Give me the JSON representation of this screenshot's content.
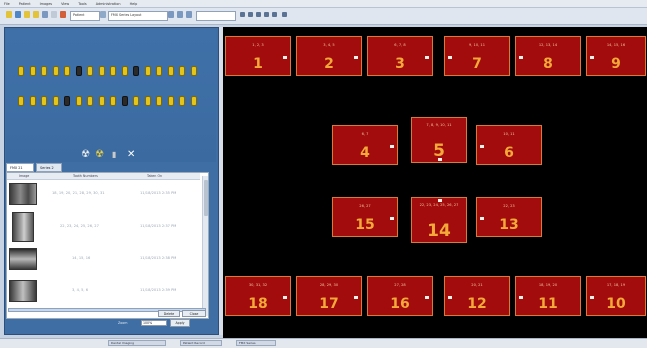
{
  "menubar": [
    "File",
    "Patient",
    "Images",
    "View",
    "Tools",
    "Administration",
    "Help"
  ],
  "toolbar": {
    "combo_left": "Patient",
    "combo_middle": "FMX Series Layout",
    "combo_right": ""
  },
  "tabs": [
    {
      "label": "FMX 21"
    },
    {
      "label": "Series 2"
    }
  ],
  "list": {
    "columns": [
      "Image",
      "Tooth Numbers",
      "Taken On"
    ],
    "rows": [
      {
        "teeth": "18, 19, 20, 21, 28, 29, 30, 31",
        "date": "11/18/2013 2:35 PM"
      },
      {
        "teeth": "22, 23, 24, 25, 26, 27",
        "date": "11/18/2013 2:37 PM"
      },
      {
        "teeth": "14, 15, 16",
        "date": "11/18/2013 2:38 PM"
      },
      {
        "teeth": "3, 4, 5, 6",
        "date": "11/18/2013 2:39 PM"
      }
    ]
  },
  "buttons": {
    "delete": "Delete",
    "close": "Close",
    "apply": "Apply"
  },
  "zoom": {
    "label": "Zoom",
    "value": "100%"
  },
  "slots": [
    {
      "number": "1",
      "teeth": "1, 2, 3"
    },
    {
      "number": "2",
      "teeth": "3, 4, 5"
    },
    {
      "number": "3",
      "teeth": "6, 7, 8"
    },
    {
      "number": "7",
      "teeth": "9, 10, 11"
    },
    {
      "number": "8",
      "teeth": "12, 13, 14"
    },
    {
      "number": "9",
      "teeth": "14, 15, 16"
    },
    {
      "number": "4",
      "teeth": "6, 7"
    },
    {
      "number": "5",
      "teeth": "7, 8, 9, 10, 11"
    },
    {
      "number": "6",
      "teeth": "10, 11"
    },
    {
      "number": "15",
      "teeth": "26, 27"
    },
    {
      "number": "14",
      "teeth": "22, 23, 24, 25, 26, 27"
    },
    {
      "number": "13",
      "teeth": "22, 23"
    },
    {
      "number": "18",
      "teeth": "30, 31, 32"
    },
    {
      "number": "17",
      "teeth": "28, 29, 30"
    },
    {
      "number": "16",
      "teeth": "27, 28"
    },
    {
      "number": "12",
      "teeth": "20, 21"
    },
    {
      "number": "11",
      "teeth": "18, 19, 20"
    },
    {
      "number": "10",
      "teeth": "17, 18, 19"
    }
  ],
  "taskbar": [
    "Dental Imaging",
    "Patient Record",
    "FMX Series"
  ],
  "colors": {
    "slot_fill": "#a20c0c",
    "slot_number": "#f2a93a",
    "canvas": "#000000",
    "panel": "#3e6ea4"
  },
  "icons": [
    "xray-sensor-icon",
    "radiation-icon",
    "pointer-icon",
    "close-icon"
  ]
}
